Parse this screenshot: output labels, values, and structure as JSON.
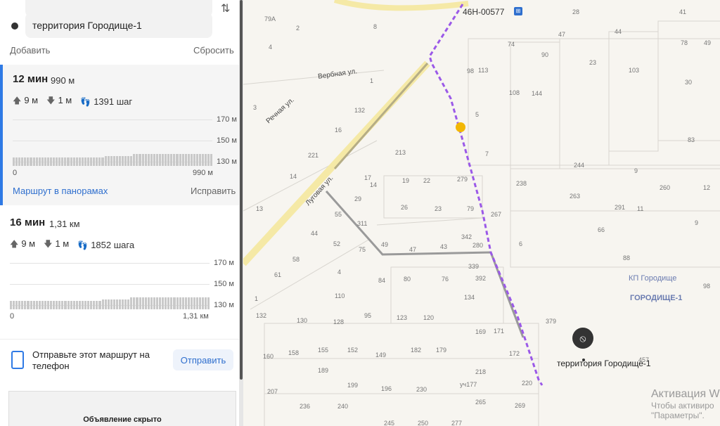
{
  "panel": {
    "from_field": "",
    "dest_field": "территория Городище-1",
    "add_link": "Добавить",
    "reset_link": "Сбросить"
  },
  "routes": [
    {
      "time": "12 мин",
      "distance": "990 м",
      "ascent": "9 м",
      "descent": "1 м",
      "steps": "1391 шаг",
      "elevation_ticks": [
        "170 м",
        "150 м",
        "130 м"
      ],
      "x_start": "0",
      "x_end": "990 м",
      "panorama_link": "Маршрут в панорамах",
      "fix_link": "Исправить"
    },
    {
      "time": "16 мин",
      "distance": "1,31 км",
      "ascent": "9 м",
      "descent": "1 м",
      "steps": "1852 шага",
      "elevation_ticks": [
        "170 м",
        "150 м",
        "130 м"
      ],
      "x_start": "0",
      "x_end": "1,31 км"
    }
  ],
  "phone": {
    "text": "Отправьте этот маршрут на телефон",
    "button": "Отправить"
  },
  "ad": {
    "label": "Объявление скрыто"
  },
  "map": {
    "bus_stop": "46Н-00577",
    "destination_label": "территория Городище-1",
    "area_labels": [
      "КП Городище",
      "ГОРОДИЩЕ-1"
    ],
    "streets": [
      "Вербная ул.",
      "Речная ул.",
      "Луговая ул."
    ],
    "house_numbers": [
      "79А",
      "2",
      "8",
      "4",
      "1",
      "14",
      "28",
      "41",
      "47",
      "44",
      "49",
      "74",
      "90",
      "23",
      "78",
      "98",
      "113",
      "103",
      "108",
      "144",
      "30",
      "3",
      "132",
      "5",
      "16",
      "213",
      "83",
      "7",
      "221",
      "244",
      "9",
      "14",
      "17",
      "19",
      "22",
      "279",
      "238",
      "263",
      "260",
      "12",
      "13",
      "29",
      "26",
      "23",
      "79",
      "267",
      "291",
      "11",
      "55",
      "311",
      "9",
      "44",
      "342",
      "66",
      "52",
      "49",
      "47",
      "43",
      "280",
      "6",
      "58",
      "75",
      "339",
      "88",
      "4",
      "61",
      "84",
      "80",
      "76",
      "392",
      "98",
      "110",
      "134",
      "1",
      "132",
      "130",
      "128",
      "95",
      "123",
      "120",
      "379",
      "169",
      "171",
      "160",
      "158",
      "155",
      "152",
      "149",
      "182",
      "179",
      "172",
      "457",
      "189",
      "218",
      "207",
      "199",
      "196",
      "230",
      "уч177",
      "220",
      "236",
      "240",
      "265",
      "269",
      "245",
      "250",
      "277"
    ],
    "watermark_title": "Активация W",
    "watermark_line1": "Чтобы активиро",
    "watermark_line2": "\"Параметры\"."
  },
  "colors": {
    "accent": "#2f7ae5",
    "walk_route": "#9b59e8",
    "alt_route": "#9a9a9a"
  }
}
